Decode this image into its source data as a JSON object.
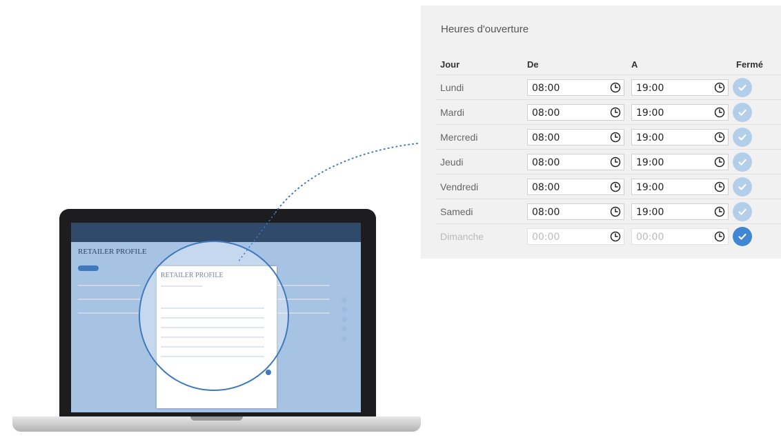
{
  "hours": {
    "title": "Heures d'ouverture",
    "headers": {
      "day": "Jour",
      "from": "De",
      "to": "A",
      "closed": "Fermé"
    },
    "rows": [
      {
        "day": "Lundi",
        "from": "08:00",
        "to": "19:00",
        "closed": false
      },
      {
        "day": "Mardi",
        "from": "08:00",
        "to": "19:00",
        "closed": false
      },
      {
        "day": "Mercredi",
        "from": "08:00",
        "to": "19:00",
        "closed": false
      },
      {
        "day": "Jeudi",
        "from": "08:00",
        "to": "19:00",
        "closed": false
      },
      {
        "day": "Vendredi",
        "from": "08:00",
        "to": "19:00",
        "closed": false
      },
      {
        "day": "Samedi",
        "from": "08:00",
        "to": "19:00",
        "closed": false
      },
      {
        "day": "Dimanche",
        "from": "00:00",
        "to": "00:00",
        "closed": true
      }
    ]
  },
  "laptop": {
    "page_title": "RETAILER PROFILE",
    "card_title": "RETAILER PROFILE"
  },
  "icons": {
    "time": "clock-icon",
    "closed": "check-icon"
  },
  "colors": {
    "check_active": "#3f87d2",
    "check_inactive": "#b3cee8",
    "accent": "#3f79bd"
  }
}
